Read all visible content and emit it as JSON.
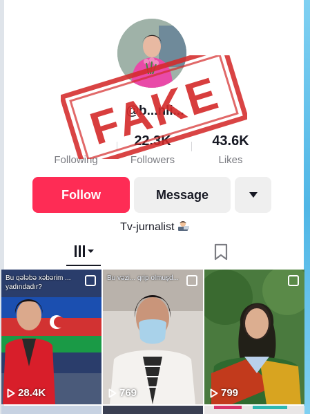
{
  "profile": {
    "username": "@b...nli...",
    "stats": {
      "following_value": "",
      "following_label": "Following",
      "followers_value": "22.3K",
      "followers_label": "Followers",
      "likes_value": "43.6K",
      "likes_label": "Likes"
    },
    "bio": "Tv-jurnalist"
  },
  "actions": {
    "follow_label": "Follow",
    "message_label": "Message"
  },
  "overlay": {
    "stamp_text": "FAKE",
    "stamp_color": "#d42a2a"
  },
  "tabs": [
    {
      "name": "videos-grid",
      "active": true
    },
    {
      "name": "saved-bookmark",
      "active": false
    }
  ],
  "videos": [
    {
      "caption": "Bu qələbə xəbərim ...\nyadındadır?",
      "views": "28.4K"
    },
    {
      "caption": "Bu vəzi... qrip olmuşd...",
      "views": "769"
    },
    {
      "caption": "",
      "views": "799"
    }
  ],
  "colors": {
    "brand_red": "#fe2c55",
    "secondary_btn": "#efefef",
    "text": "#161823",
    "muted": "#7b7c82"
  }
}
